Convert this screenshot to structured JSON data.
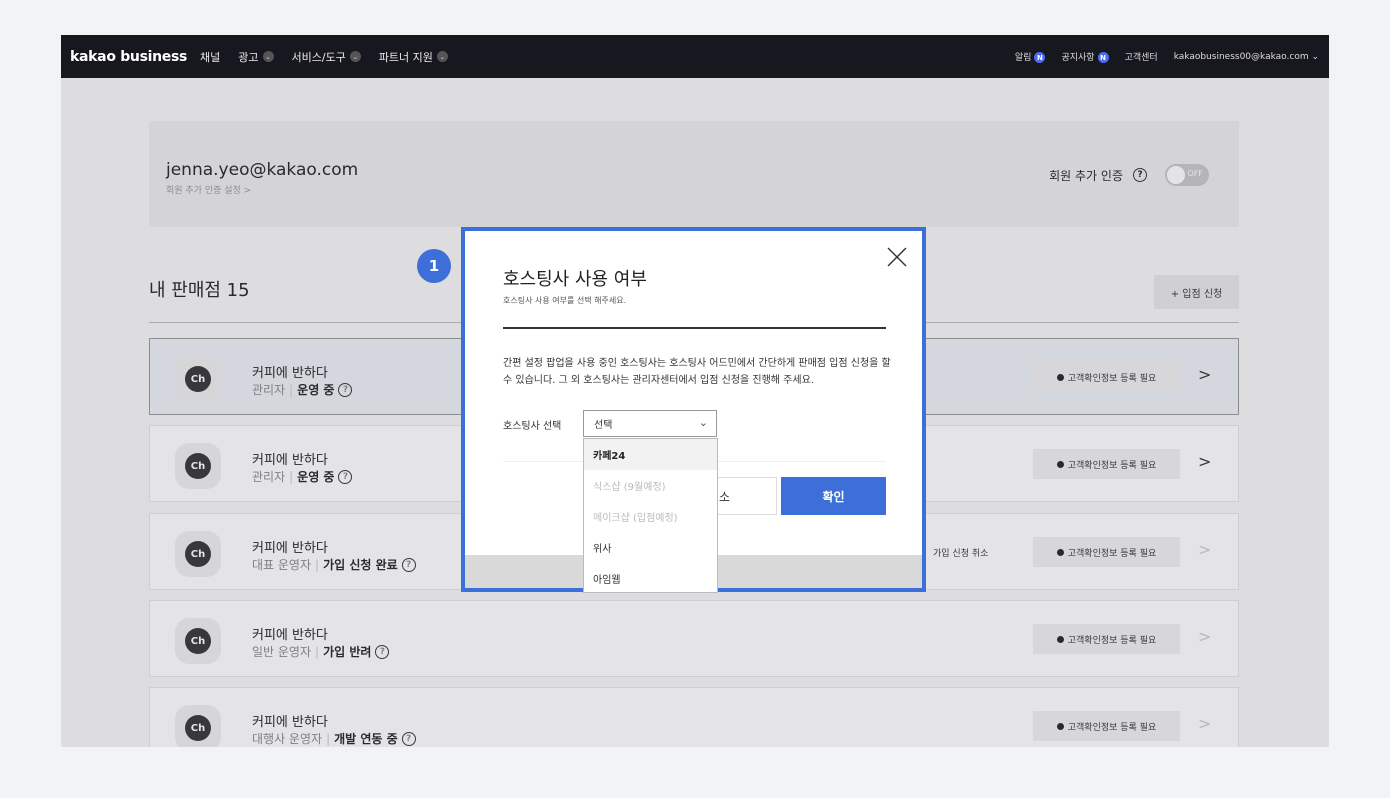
{
  "gnb": {
    "logo": "kakao business",
    "nav": [
      {
        "label": "채널",
        "has_chevron": false
      },
      {
        "label": "광고",
        "has_chevron": true
      },
      {
        "label": "서비스/도구",
        "has_chevron": true
      },
      {
        "label": "파트너 지원",
        "has_chevron": true
      }
    ],
    "alarm": "알림",
    "notice": "공지사항",
    "new_badge": "N",
    "support": "고객센터",
    "account": "kakaobusiness00@kakao.com ⌄",
    "chevron": "⌄"
  },
  "profile": {
    "email": "jenna.yeo@kakao.com",
    "sub": "회원 추가 인증 설정 >",
    "auth_label": "회원 추가 인증",
    "help": "?",
    "toggle_label": "OFF"
  },
  "stores_section": {
    "title": "내 판매점 15",
    "apply_button": "+ 입점 신청"
  },
  "stores": [
    {
      "name": "커피에 반하다",
      "role": "관리자",
      "status": "운영 중",
      "badge": "고객확인정보 등록 필요",
      "cancel": "",
      "arrow": ">"
    },
    {
      "name": "커피에 반하다",
      "role": "관리자",
      "status": "운영 중",
      "badge": "고객확인정보 등록 필요",
      "cancel": "",
      "arrow": ">"
    },
    {
      "name": "커피에 반하다",
      "role": "대표 운영자",
      "status": "가입 신청 완료",
      "badge": "고객확인정보 등록 필요",
      "cancel": "가입 신청 취소",
      "arrow": ">"
    },
    {
      "name": "커피에 반하다",
      "role": "일반 운영자",
      "status": "가입 반려",
      "badge": "고객확인정보 등록 필요",
      "cancel": "",
      "arrow": ">"
    },
    {
      "name": "커피에 반하다",
      "role": "대행사 운영자",
      "status": "개발 연동 중",
      "badge": "고객확인정보 등록 필요",
      "cancel": "",
      "arrow": ">"
    }
  ],
  "store_icon_text": "Ch",
  "step_number": "1",
  "modal": {
    "title": "호스팅사 사용 여부",
    "subtitle": "호스팅사 사용 여부를 선택 해주세요.",
    "description": "간편 설정 팝업을 사용 중인 호스팅사는 호스팅사 어드민에서 간단하게 판매점 입점 신청을 할 수 있습니다. 그 외 호스팅사는 관리자센터에서 입점 신청을 진행해 주세요.",
    "select_label": "호스팅사 선택",
    "select_value": "선택",
    "select_chevron": "⌄",
    "cancel_button": "소",
    "confirm_button": "확인"
  },
  "dropdown_options": [
    {
      "label": "카페24",
      "state": "active"
    },
    {
      "label": "식스샵 (9월예정)",
      "state": "disabled"
    },
    {
      "label": "메이크샵 (입점예정)",
      "state": "disabled"
    },
    {
      "label": "위사",
      "state": "normal"
    },
    {
      "label": "아임웹",
      "state": "normal"
    }
  ],
  "colors": {
    "accent": "#3e6fd8",
    "gnb_bg": "#17171f",
    "new_badge": "#4a6cf7"
  }
}
